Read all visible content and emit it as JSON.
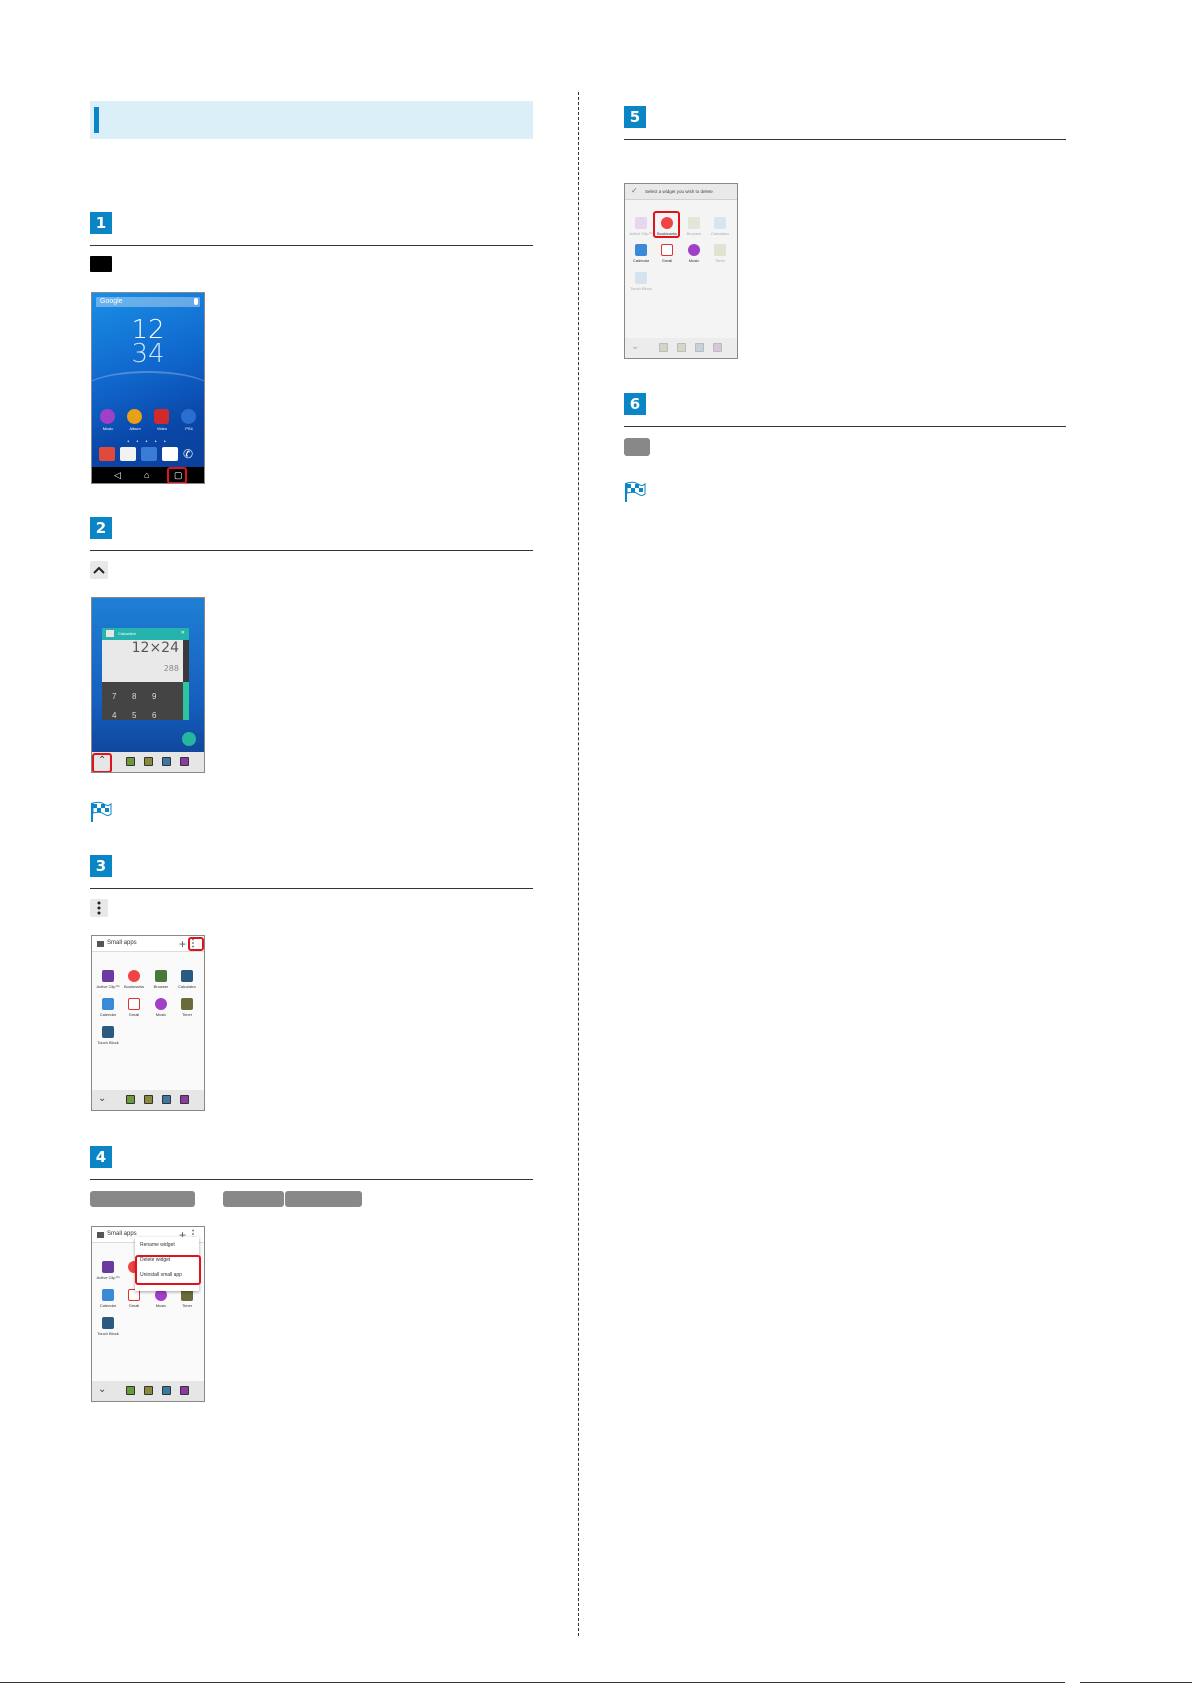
{
  "steps": [
    {
      "number": "1"
    },
    {
      "number": "2"
    },
    {
      "number": "3"
    },
    {
      "number": "4"
    },
    {
      "number": "5"
    },
    {
      "number": "6"
    }
  ],
  "home_screen": {
    "search_label": "Google",
    "clock_hour": "12",
    "clock_minute": "34",
    "apps": [
      "Music",
      "Album",
      "Video",
      "PS4"
    ]
  },
  "recent_screen": {
    "card_title": "Calculator",
    "expression": "12×24",
    "result": "288",
    "keys": [
      "7",
      "8",
      "9",
      "4",
      "5",
      "6"
    ]
  },
  "small_apps": {
    "title": "Small apps",
    "apps": [
      "Active Clip™",
      "Bookmarks",
      "Browser",
      "Calculator",
      "Calendar",
      "Gmail",
      "Music",
      "Timer",
      "Touch Block"
    ],
    "menu": [
      "Rename widget",
      "Delete widget",
      "Uninstall small app"
    ]
  },
  "delete_screen": {
    "title": "Select a widget you wish to delete",
    "apps": [
      "Active Clip™",
      "Bookmarks",
      "Browser",
      "Calculator",
      "Calendar",
      "Gmail",
      "Music",
      "Timer",
      "Touch Block"
    ]
  },
  "colors": {
    "accent": "#0a86c6",
    "highlight": "#e0121b",
    "header_bg": "#dbeff9"
  }
}
